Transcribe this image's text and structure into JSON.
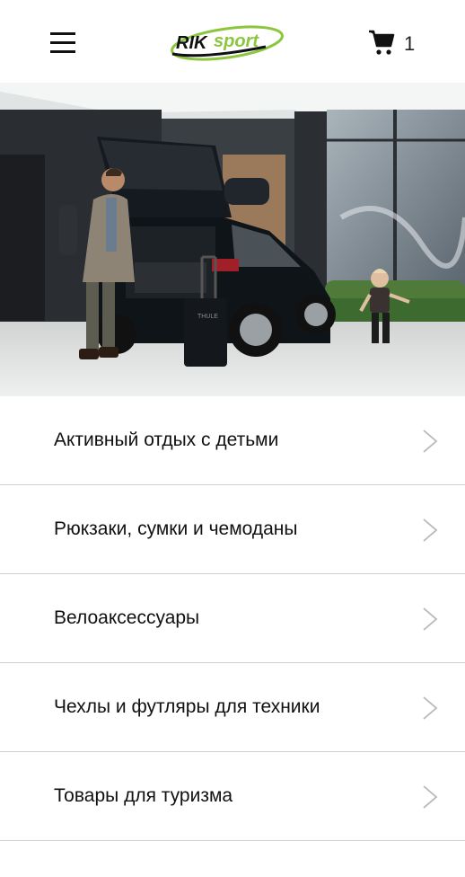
{
  "header": {
    "logo_text_a": "RIK",
    "logo_text_b": "sport",
    "menu_icon": "hamburger-icon",
    "cart_icon": "cart-icon",
    "cart_count": "1",
    "brand_color_green": "#8cc63f",
    "brand_color_dark": "#111111"
  },
  "hero": {
    "description_icon": "photo",
    "luggage_text": "THULE"
  },
  "categories": [
    {
      "label": "Активный отдых с детьми"
    },
    {
      "label": "Рюкзаки, сумки и чемоданы"
    },
    {
      "label": "Велоаксессуары"
    },
    {
      "label": "Чехлы и футляры для техники"
    },
    {
      "label": "Товары для туризма"
    }
  ]
}
